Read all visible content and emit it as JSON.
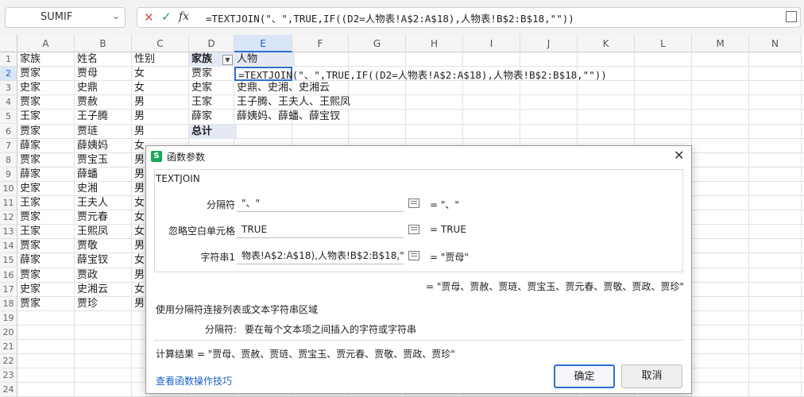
{
  "formula_bar": {
    "name_box": "SUMIF",
    "cancel_icon": "x-icon",
    "confirm_icon": "check-icon",
    "fx_label": "fx",
    "formula": "=TEXTJOIN(\"、\",TRUE,IF((D2=人物表!A$2:A$18),人物表!B$2:B$18,\"\"))"
  },
  "sheet": {
    "columns": [
      "A",
      "B",
      "C",
      "D",
      "E",
      "F",
      "G",
      "H",
      "I",
      "J",
      "K",
      "L",
      "M",
      "N"
    ],
    "rows": [
      "1",
      "2",
      "3",
      "4",
      "5",
      "6",
      "7",
      "8",
      "9",
      "10",
      "11",
      "12",
      "13",
      "14",
      "15",
      "16",
      "17",
      "18",
      "19",
      "20",
      "21",
      "22",
      "23",
      "24"
    ],
    "colA": [
      "家族",
      "贾家",
      "史家",
      "贾家",
      "王家",
      "贾家",
      "薛家",
      "贾家",
      "薛家",
      "史家",
      "王家",
      "贾家",
      "王家",
      "贾家",
      "薛家",
      "贾家",
      "史家",
      "贾家"
    ],
    "colB": [
      "姓名",
      "贾母",
      "史鼎",
      "贾赦",
      "王子腾",
      "贾琏",
      "薛姨妈",
      "贾宝玉",
      "薛蟠",
      "史湘",
      "王夫人",
      "贾元春",
      "王熙凤",
      "贾敬",
      "薛宝钗",
      "贾政",
      "史湘云",
      "贾珍"
    ],
    "colC": [
      "性别",
      "女",
      "女",
      "男",
      "男",
      "男",
      "女",
      "男",
      "男",
      "男",
      "女",
      "女",
      "女",
      "男",
      "女",
      "男",
      "女",
      "男"
    ],
    "colD": [
      "家族",
      "贾家",
      "史家",
      "王家",
      "薛家",
      "总计"
    ],
    "colE": [
      "人物",
      "=TEXTJOIN(\"、\",TRUE,IF((D2=人物表!A$2:A$18),人物表!B$2:B$18,\"\"))",
      "史鼎、史湘、史湘云",
      "王子腾、王夫人、王熙凤",
      "薛姨妈、薛蟠、薛宝钗"
    ]
  },
  "dialog": {
    "title": "函数参数",
    "app_icon": "S",
    "function_name": "TEXTJOIN",
    "args": [
      {
        "label": "分隔符",
        "value": "\"、\"",
        "result": "= \"、\""
      },
      {
        "label": "忽略空白单元格",
        "value": "TRUE",
        "result": "= TRUE"
      },
      {
        "label": "字符串1",
        "value": "物表!A$2:A$18),人物表!B$2:B$18,\"\")",
        "result": "= \"贾母\""
      }
    ],
    "total_result": "= \"贾母、贾赦、贾琏、贾宝玉、贾元春、贾敬、贾政、贾珍\"",
    "description": "使用分隔符连接列表或文本字符串区域",
    "param_name": "分隔符:",
    "param_desc": "要在每个文本项之间插入的字符或字符串",
    "calc_result": "计算结果 = \"贾母、贾赦、贾琏、贾宝玉、贾元春、贾敬、贾政、贾珍\"",
    "help_link": "查看函数操作技巧",
    "ok_label": "确定",
    "cancel_label": "取消"
  }
}
